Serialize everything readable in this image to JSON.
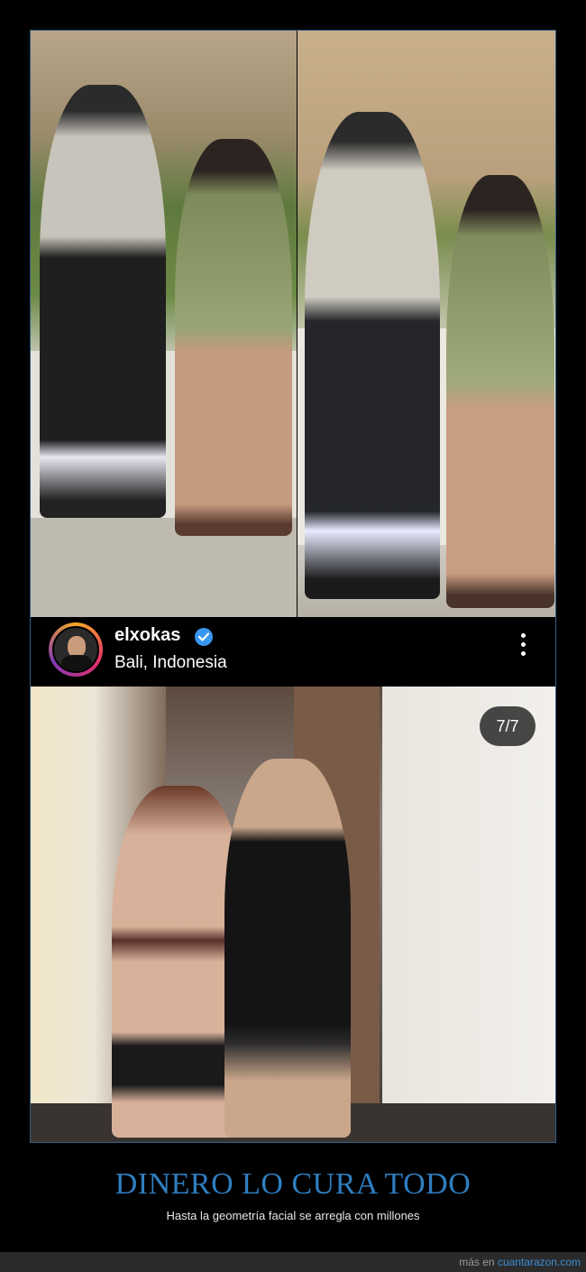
{
  "profile": {
    "username": "elxokas",
    "location": "Bali, Indonesia",
    "verified": true,
    "more_icon": "more-vertical-icon"
  },
  "carousel": {
    "counter": "7/7"
  },
  "meme": {
    "title": "DINERO LO CURA TODO",
    "subtitle": "Hasta la geometría facial se arregla con millones"
  },
  "footer": {
    "prefix": "más en",
    "site": "cuantarazon.com"
  },
  "colors": {
    "title": "#2f7ec0",
    "verified_badge": "#3897f0",
    "frame_border": "#2f5f86",
    "link": "#3b8fd6"
  }
}
